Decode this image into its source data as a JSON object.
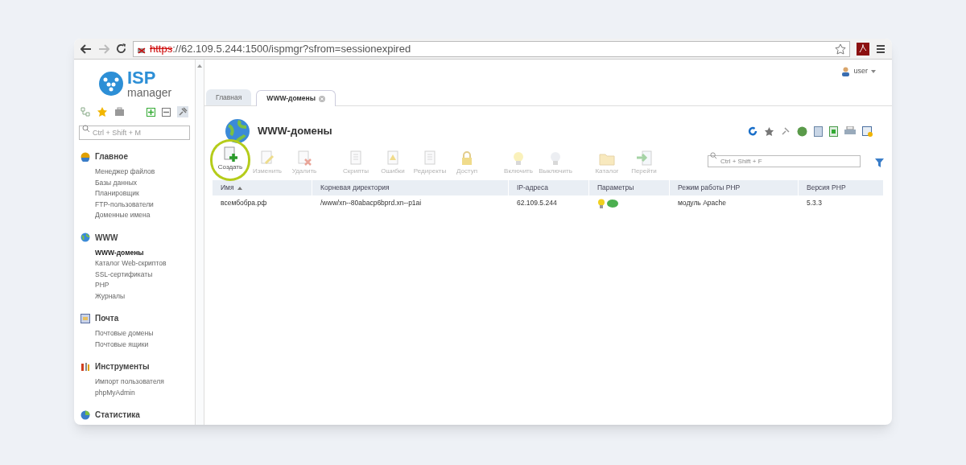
{
  "browser": {
    "url_scheme": "https",
    "url_rest": "://62.109.5.244:1500/ispmgr?sfrom=sessionexpired"
  },
  "logo": {
    "top": "ISP",
    "bottom": "manager"
  },
  "user": "user",
  "tabs": [
    {
      "label": "Главная",
      "selected": false,
      "closable": false
    },
    {
      "label": "WWW-домены",
      "selected": true,
      "closable": true
    }
  ],
  "sidebar": {
    "search": {
      "placeholder": "Ctrl + Shift + M"
    },
    "groups": [
      {
        "title": "Главное",
        "kind": "home",
        "items": [
          {
            "label": "Менеджер файлов",
            "selected": false
          },
          {
            "label": "Базы данных",
            "selected": false
          },
          {
            "label": "Планировщик",
            "selected": false
          },
          {
            "label": "FTP-пользователи",
            "selected": false
          },
          {
            "label": "Доменные имена",
            "selected": false
          }
        ]
      },
      {
        "title": "WWW",
        "kind": "www",
        "items": [
          {
            "label": "WWW-домены",
            "selected": true
          },
          {
            "label": "Каталог Web-скриптов",
            "selected": false
          },
          {
            "label": "SSL-сертификаты",
            "selected": false
          },
          {
            "label": "PHP",
            "selected": false
          },
          {
            "label": "Журналы",
            "selected": false
          }
        ]
      },
      {
        "title": "Почта",
        "kind": "mail",
        "items": [
          {
            "label": "Почтовые домены",
            "selected": false
          },
          {
            "label": "Почтовые ящики",
            "selected": false
          }
        ]
      },
      {
        "title": "Инструменты",
        "kind": "tools",
        "items": [
          {
            "label": "Импорт пользователя",
            "selected": false
          },
          {
            "label": "phpMyAdmin",
            "selected": false
          }
        ]
      },
      {
        "title": "Статистика",
        "kind": "stats"
      }
    ]
  },
  "page_title": "WWW-домены",
  "toolbar": [
    {
      "label": "Создать",
      "disabled": false,
      "highlighted": true,
      "kind": "add"
    },
    {
      "label": "Изменить",
      "disabled": true,
      "highlighted": false,
      "kind": "edit"
    },
    {
      "label": "Удалить",
      "disabled": true,
      "highlighted": false,
      "kind": "delete"
    },
    {
      "label": "Скрипты",
      "disabled": true,
      "highlighted": false,
      "kind": "doc"
    },
    {
      "label": "Ошибки",
      "disabled": true,
      "highlighted": false,
      "kind": "warn"
    },
    {
      "label": "Редиректы",
      "disabled": true,
      "highlighted": false,
      "kind": "doc"
    },
    {
      "label": "Доступ",
      "disabled": true,
      "highlighted": false,
      "kind": "lock"
    },
    {
      "label": "Включить",
      "disabled": true,
      "highlighted": false,
      "kind": "bulb-on"
    },
    {
      "label": "Выключить",
      "disabled": true,
      "highlighted": false,
      "kind": "bulb-off"
    },
    {
      "label": "Каталог",
      "disabled": true,
      "highlighted": false,
      "kind": "folder"
    },
    {
      "label": "Перейти",
      "disabled": true,
      "highlighted": false,
      "kind": "go"
    }
  ],
  "filter": {
    "placeholder": "Ctrl + Shift + F"
  },
  "table": {
    "columns": [
      {
        "label": "Имя",
        "sorted": true
      },
      {
        "label": "Корневая директория",
        "sorted": false
      },
      {
        "label": "IP-адреса",
        "sorted": false
      },
      {
        "label": "Параметры",
        "sorted": false
      },
      {
        "label": "Режим работы PHP",
        "sorted": false
      },
      {
        "label": "Версия PHP",
        "sorted": false
      }
    ],
    "rows": [
      {
        "name": "всембобра.рф",
        "root": "/www/xn--80abacp6bprd.xn--p1ai",
        "ip": "62.109.5.244",
        "php_mode": "модуль Apache",
        "php_version": "5.3.3"
      }
    ]
  }
}
